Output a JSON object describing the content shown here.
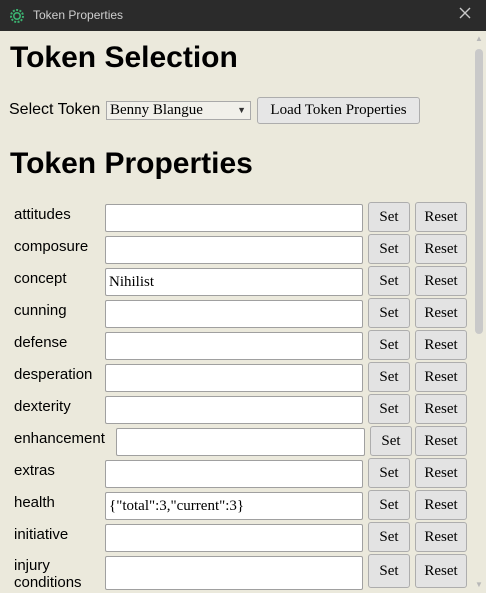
{
  "window": {
    "title": "Token Properties",
    "app_icon": "gear-icon",
    "close_icon": "close-icon"
  },
  "selection": {
    "heading": "Token Selection",
    "select_label": "Select Token",
    "selected_token": "Benny Blangue",
    "load_button": "Load Token Properties"
  },
  "properties": {
    "heading": "Token Properties",
    "set_label": "Set",
    "reset_label": "Reset",
    "rows": [
      {
        "name": "attitudes",
        "value": ""
      },
      {
        "name": "composure",
        "value": ""
      },
      {
        "name": "concept",
        "value": "Nihilist"
      },
      {
        "name": "cunning",
        "value": ""
      },
      {
        "name": "defense",
        "value": ""
      },
      {
        "name": "desperation",
        "value": ""
      },
      {
        "name": "dexterity",
        "value": ""
      },
      {
        "name": "enhancement",
        "value": ""
      },
      {
        "name": "extras",
        "value": ""
      },
      {
        "name": "health",
        "value": "{\"total\":3,\"current\":3}"
      },
      {
        "name": "initiative",
        "value": ""
      },
      {
        "name": "injury conditions",
        "value": ""
      }
    ]
  }
}
